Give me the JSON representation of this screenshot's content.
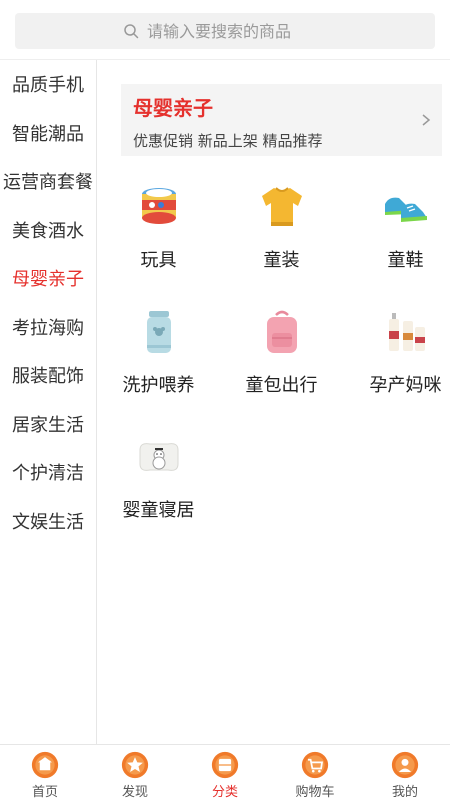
{
  "search": {
    "placeholder": "请输入要搜索的商品"
  },
  "sidebar": {
    "items": [
      {
        "label": "品质手机"
      },
      {
        "label": "智能潮品"
      },
      {
        "label": "运营商套餐"
      },
      {
        "label": "美食酒水"
      },
      {
        "label": "母婴亲子",
        "active": true
      },
      {
        "label": "考拉海购"
      },
      {
        "label": "服装配饰"
      },
      {
        "label": "居家生活"
      },
      {
        "label": "个护清洁"
      },
      {
        "label": "文娱生活"
      }
    ]
  },
  "banner": {
    "title": "母婴亲子",
    "subtitle": "优惠促销 新品上架 精品推荐"
  },
  "categories": [
    {
      "label": "玩具",
      "icon": "toy-drum-icon"
    },
    {
      "label": "童装",
      "icon": "kids-sweater-icon"
    },
    {
      "label": "童鞋",
      "icon": "kids-shoes-icon"
    },
    {
      "label": "洗护喂养",
      "icon": "baby-bottle-icon"
    },
    {
      "label": "童包出行",
      "icon": "kids-backpack-icon"
    },
    {
      "label": "孕产妈咪",
      "icon": "maternity-lotion-icon"
    },
    {
      "label": "婴童寝居",
      "icon": "baby-pillow-icon"
    }
  ],
  "tabbar": {
    "items": [
      {
        "label": "首页",
        "icon": "home-icon"
      },
      {
        "label": "发现",
        "icon": "star-icon"
      },
      {
        "label": "分类",
        "icon": "category-icon",
        "active": true
      },
      {
        "label": "购物车",
        "icon": "cart-icon"
      },
      {
        "label": "我的",
        "icon": "profile-icon"
      }
    ]
  },
  "colors": {
    "accent": "#e5312d",
    "tab_icon": "#f07a2a"
  }
}
